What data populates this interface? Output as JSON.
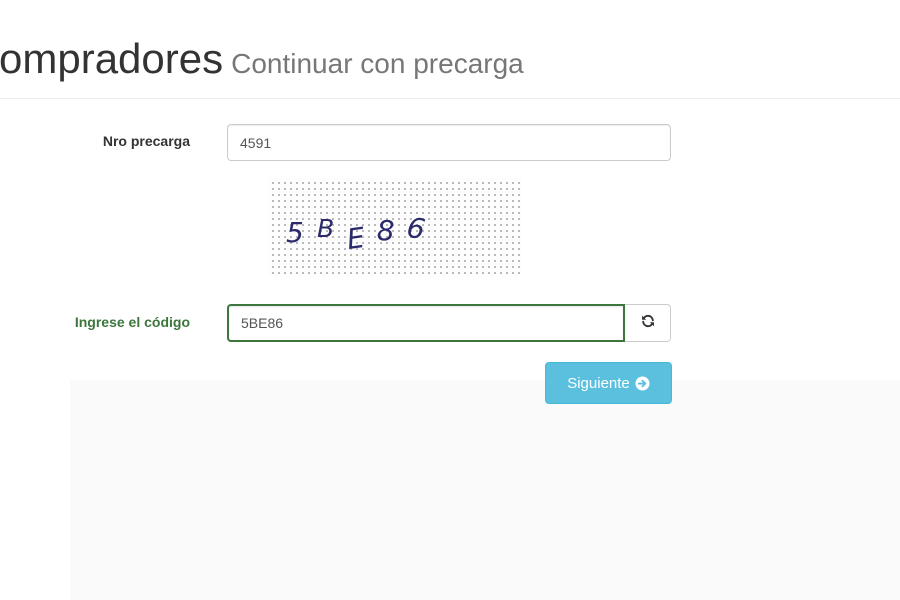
{
  "header": {
    "title": "ompradores",
    "subtitle": "Continuar con precarga"
  },
  "form": {
    "precarga_label": "Nro precarga",
    "precarga_value": "4591",
    "captcha_characters": [
      "5",
      "B",
      "E",
      "8",
      "6"
    ],
    "codigo_label": "Ingrese el código",
    "codigo_value": "5BE86",
    "refresh_icon": "refresh-icon",
    "next_label": "Siguiente",
    "next_icon": "arrow-circle-right-icon"
  },
  "colors": {
    "label_success": "#3c763d",
    "input_success_border": "#3c763d",
    "button_info": "#5bc0de",
    "captcha_text": "#2b2a6b"
  }
}
